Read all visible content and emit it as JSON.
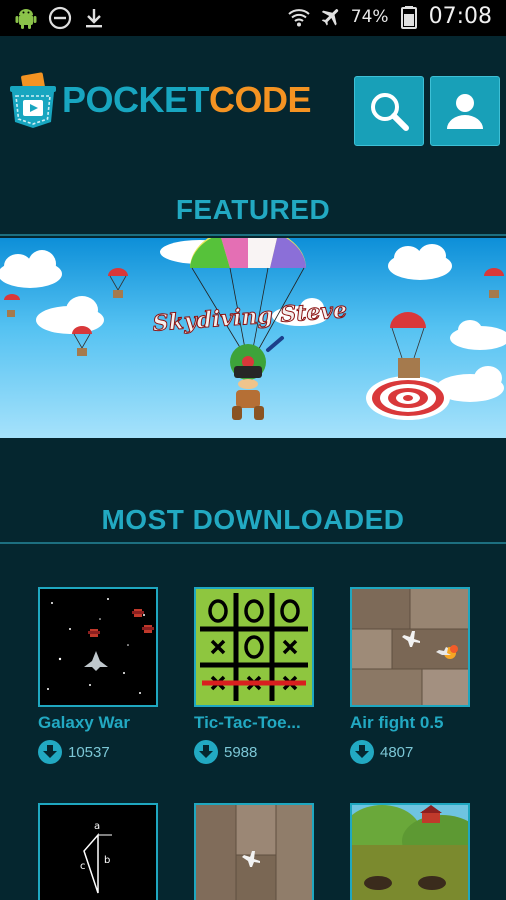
{
  "status_bar": {
    "battery_percent": "74%",
    "time": "07:08",
    "icons": [
      "android-icon",
      "do-not-disturb-icon",
      "download-icon",
      "wifi-icon",
      "airplane-icon",
      "battery-icon"
    ]
  },
  "header": {
    "logo_text_part1": "POCKET",
    "logo_text_part2": "CODE",
    "search_icon": "search-icon",
    "profile_icon": "user-icon"
  },
  "colors": {
    "background": "#05262f",
    "accent": "#22a9c2",
    "button": "#18a0b8",
    "logo_orange": "#f49322"
  },
  "featured": {
    "title": "FEATURED",
    "banner_title": "Skydiving Steve"
  },
  "most_downloaded": {
    "title": "MOST DOWNLOADED",
    "items": [
      {
        "title": "Galaxy War",
        "downloads": "10537"
      },
      {
        "title": "Tic-Tac-Toe...",
        "downloads": "5988"
      },
      {
        "title": "Air fight 0.5",
        "downloads": "4807"
      },
      {
        "title": "",
        "downloads": ""
      },
      {
        "title": "",
        "downloads": ""
      },
      {
        "title": "",
        "downloads": ""
      }
    ]
  },
  "triangle_labels": {
    "a": "a",
    "b": "b",
    "c": "c"
  }
}
